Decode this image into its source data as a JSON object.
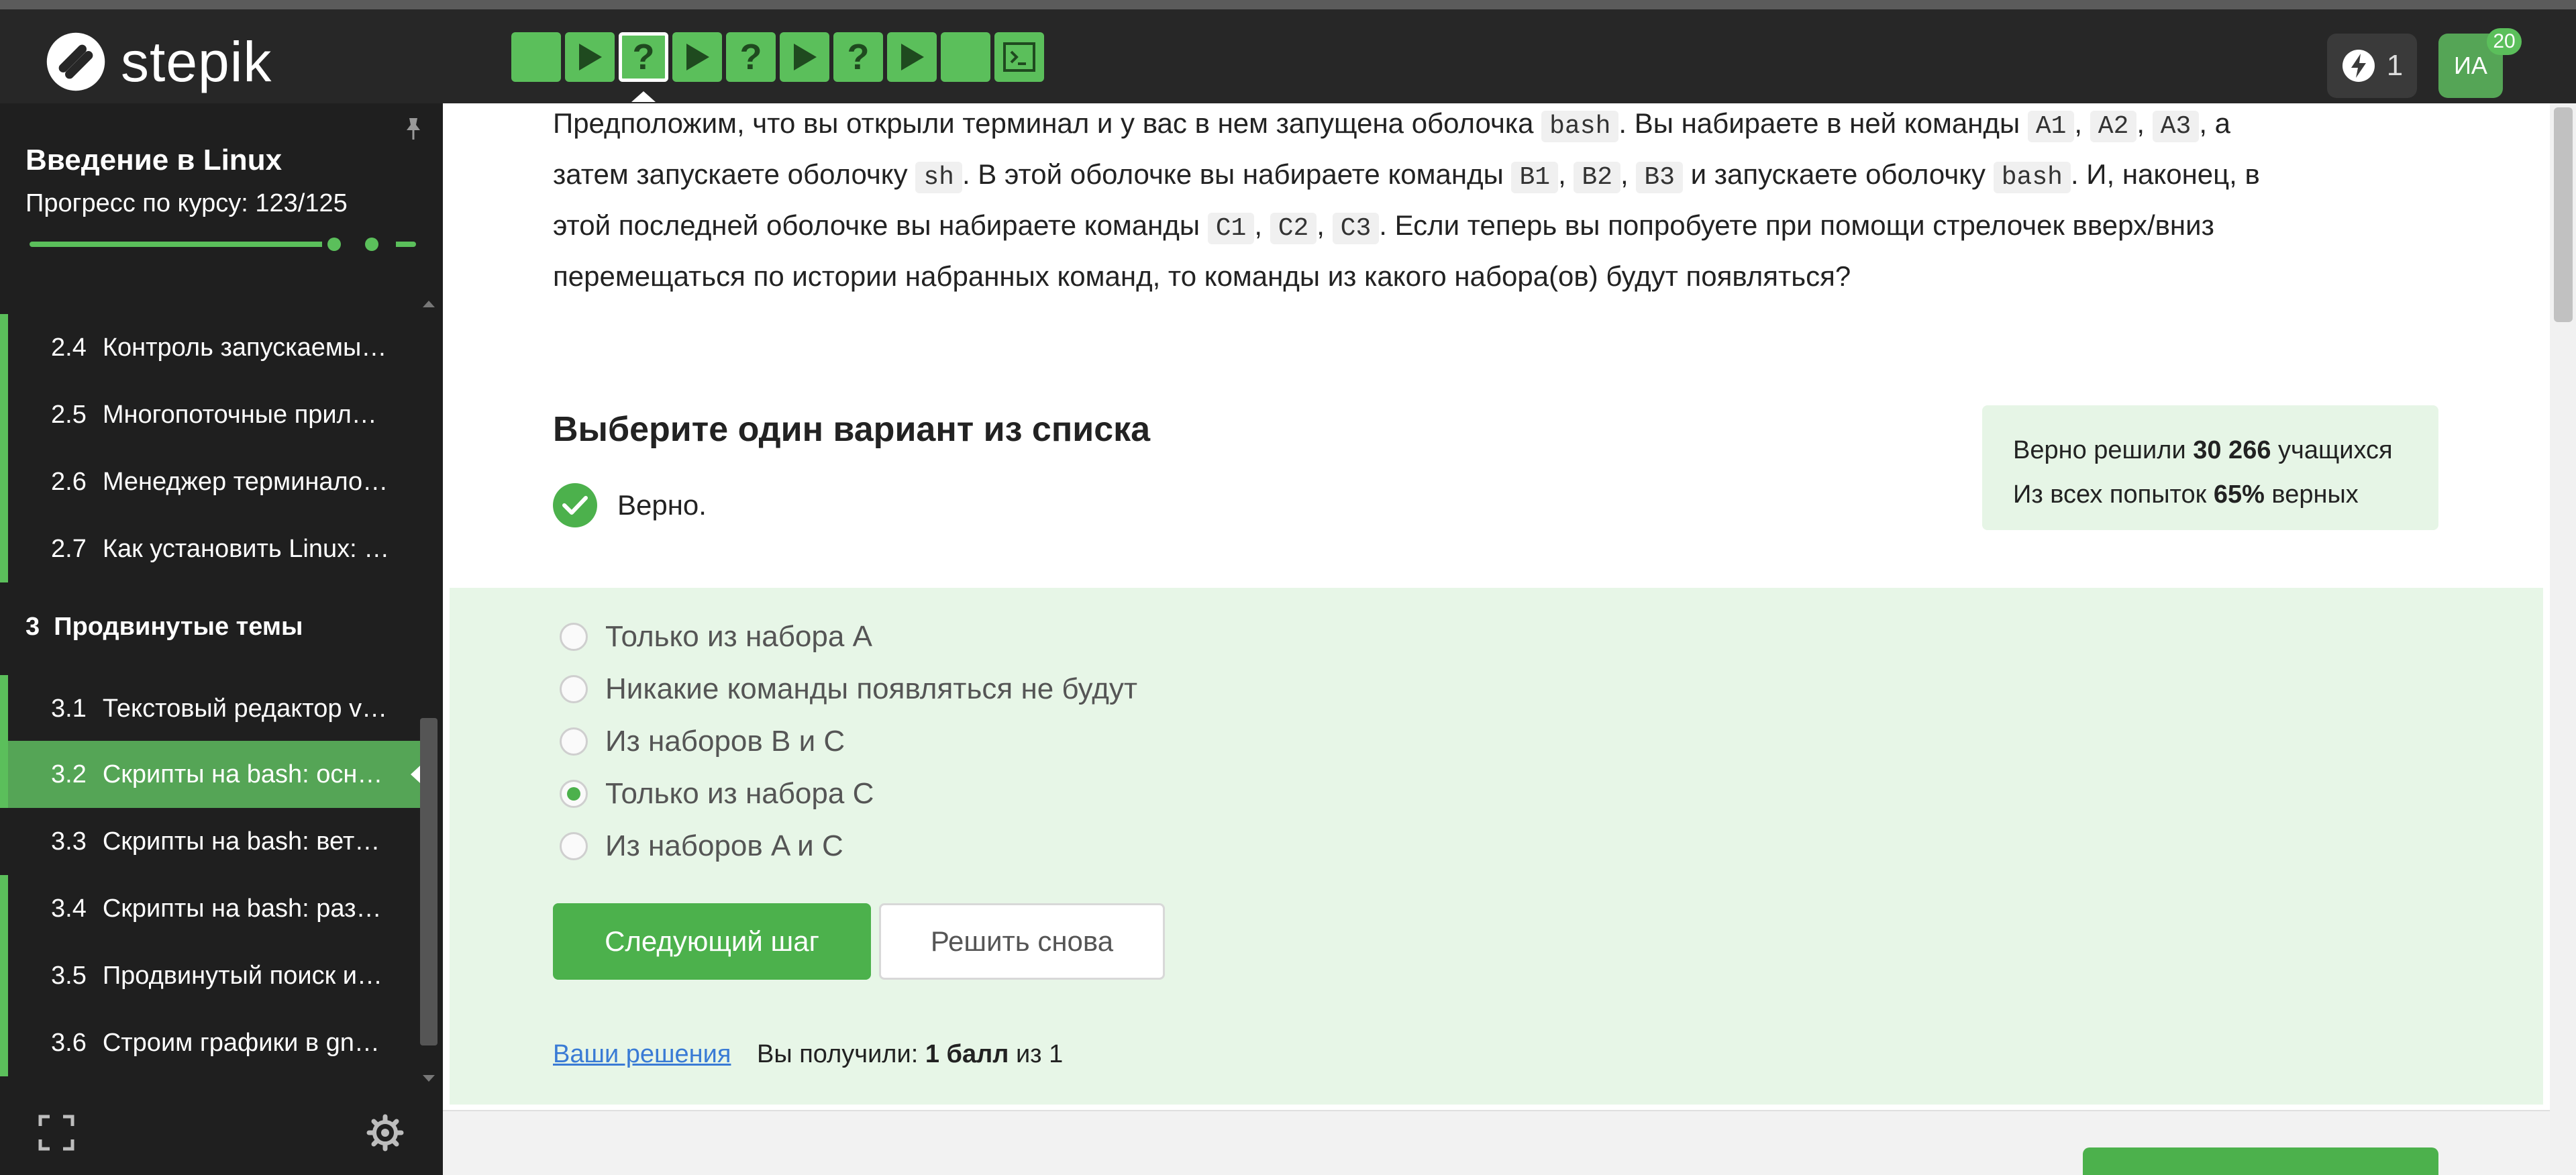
{
  "brand": {
    "name": "stepik"
  },
  "header": {
    "steps": [
      {
        "type": "text"
      },
      {
        "type": "video"
      },
      {
        "type": "quiz",
        "current": true
      },
      {
        "type": "video"
      },
      {
        "type": "quiz"
      },
      {
        "type": "video"
      },
      {
        "type": "quiz"
      },
      {
        "type": "video"
      },
      {
        "type": "text"
      },
      {
        "type": "terminal"
      }
    ],
    "quiz_symbol": "?",
    "energy_count": "1",
    "avatar_initials": "ИА",
    "avatar_badge": "20"
  },
  "sidebar": {
    "course_title": "Введение в Linux",
    "progress_label": "Прогресс по курсу:  123/125",
    "progress": {
      "done": 123,
      "total": 125
    },
    "lessons_top": [
      {
        "num": "2.4",
        "title": "Контроль запускаемы…"
      },
      {
        "num": "2.5",
        "title": "Многопоточные прил…"
      },
      {
        "num": "2.6",
        "title": "Менеджер терминало…"
      },
      {
        "num": "2.7",
        "title": "Как установить Linux: …"
      }
    ],
    "module": {
      "num": "3",
      "title": "Продвинутые темы"
    },
    "lessons_bottom": [
      {
        "num": "3.1",
        "title": "Текстовый редактор v…"
      },
      {
        "num": "3.2",
        "title": "Скрипты на bash: осн…",
        "active": true
      },
      {
        "num": "3.3",
        "title": "Скрипты на bash: вет…"
      },
      {
        "num": "3.4",
        "title": "Скрипты на bash: раз…"
      },
      {
        "num": "3.5",
        "title": "Продвинутый поиск и…"
      },
      {
        "num": "3.6",
        "title": "Строим графики в gn…"
      }
    ]
  },
  "question": {
    "t1": "Предположим, что вы открыли терминал и у вас в нем запущена оболочка ",
    "c1": "bash",
    "t2": ". Вы набираете в ней команды ",
    "a1": "A1",
    "a2": "A2",
    "a3": "A3",
    "t3": ", а затем запускаете оболочку ",
    "c2": "sh",
    "t4": ". В этой оболочке вы набираете команды ",
    "b1": "B1",
    "b2": "B2",
    "b3": "B3",
    "t5": " и запускаете оболочку ",
    "c3": "bash",
    "t6": ". И, наконец, в этой последней оболочке вы набираете команды ",
    "cc1": "C1",
    "cc2": "C2",
    "cc3": "C3",
    "t7": ". Если теперь вы попробуете при помощи стрелочек вверх/вниз перемещаться по истории набранных команд, то команды из какого набора(ов) будут появляться?",
    "comma": ", "
  },
  "quiz": {
    "title": "Выберите один вариант из списка",
    "verdict": "Верно.",
    "stats": {
      "line1_prefix": "Верно решили ",
      "line1_value": "30 266",
      "line1_suffix": " учащихся",
      "line2_prefix": "Из всех попыток ",
      "line2_value": "65%",
      "line2_suffix": " верных"
    },
    "options": [
      {
        "label": "Только из набора A",
        "checked": false
      },
      {
        "label": "Никакие команды появляться не будут",
        "checked": false
      },
      {
        "label": "Из наборов B и C",
        "checked": false
      },
      {
        "label": "Только из набора C",
        "checked": true
      },
      {
        "label": "Из наборов A и C",
        "checked": false
      }
    ],
    "next_button": "Следующий шаг",
    "retry_button": "Решить снова",
    "solutions_link": "Ваши решения",
    "score_prefix": "Вы получили: ",
    "score_value": "1 балл",
    "score_suffix": " из 1"
  },
  "colors": {
    "accent": "#5bbf5b",
    "accent_dark": "#4cb14c",
    "header_bg": "#272727",
    "sidebar_bg": "#1f1f1f",
    "panel_bg": "#e7f6e7"
  }
}
